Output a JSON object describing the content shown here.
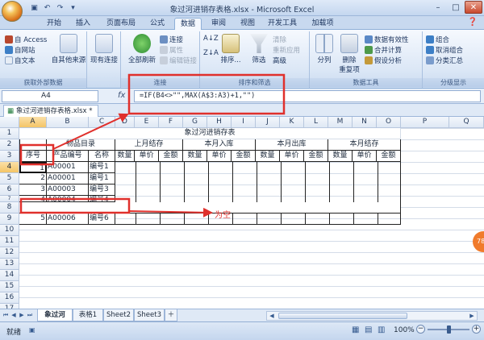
{
  "window": {
    "title": "象过河进销存表格.xlsx - Microsoft Excel"
  },
  "tabs": [
    "开始",
    "插入",
    "页面布局",
    "公式",
    "数据",
    "审阅",
    "视图",
    "开发工具",
    "加载项"
  ],
  "ribbon": {
    "groups": {
      "external": "获取外部数据",
      "connections": "连接",
      "sortfilter": "排序和筛选",
      "datatools": "数据工具",
      "outline": "分级显示"
    },
    "access": "自 Access",
    "web": "自网站",
    "text": "自文本",
    "other_sources": "自其他来源",
    "existing": "现有连接",
    "refresh_all": "全部刷新",
    "connections": "连接",
    "properties": "属性",
    "edit_links": "编辑链接",
    "sort_az": "A↓Z",
    "sort_za": "Z↓A",
    "sort": "排序...",
    "filter": "筛选",
    "clear": "清除",
    "reapply": "重新应用",
    "advanced": "高级",
    "text_to_columns": "分列",
    "remove_dup": "删除\n重复项",
    "validation": "数据有效性",
    "consolidate": "合并计算",
    "whatif": "假设分析",
    "group": "组合",
    "ungroup": "取消组合",
    "subtotal": "分类汇总"
  },
  "namebox": "A4",
  "formula": "=IF(B4<>\"\",MAX(A$3:A3)+1,\"\")",
  "doc_tab": "象过河进销存表格.xlsx *",
  "columns": [
    "A",
    "B",
    "C",
    "D",
    "E",
    "F",
    "G",
    "H",
    "I",
    "J",
    "K",
    "L",
    "M",
    "N",
    "O",
    "P",
    "Q"
  ],
  "rows": [
    "1",
    "2",
    "3",
    "4",
    "5",
    "6",
    "7",
    "8",
    "9",
    "10",
    "11",
    "12",
    "13",
    "14",
    "15",
    "16",
    "17",
    "18"
  ],
  "sheet": {
    "title": "象过河进销存表",
    "product_catalog": "物品目录",
    "last_month": "上月结存",
    "in": "本月入库",
    "out": "本月出库",
    "balance": "本月结存",
    "h_no": "序号",
    "h_code": "产品编号",
    "h_name": "名称",
    "qty": "数量",
    "price": "单价",
    "amount": "金额",
    "r4": {
      "a": "1",
      "b": "A00001",
      "c": "编号1"
    },
    "r5": {
      "a": "2",
      "b": "A00001",
      "c": "编号1"
    },
    "r6": {
      "a": "3",
      "b": "A00003",
      "c": "编号3"
    },
    "r7": {
      "a": "4",
      "b": "A00004",
      "c": "编号4"
    },
    "r9": {
      "a": "5",
      "b": "A00006",
      "c": "编号6"
    }
  },
  "annotation": "为空",
  "sheet_tabs": [
    "象过河",
    "表格1",
    "Sheet2",
    "Sheet3"
  ],
  "status": {
    "ready": "就绪",
    "zoom": "100%"
  },
  "badge": "78"
}
